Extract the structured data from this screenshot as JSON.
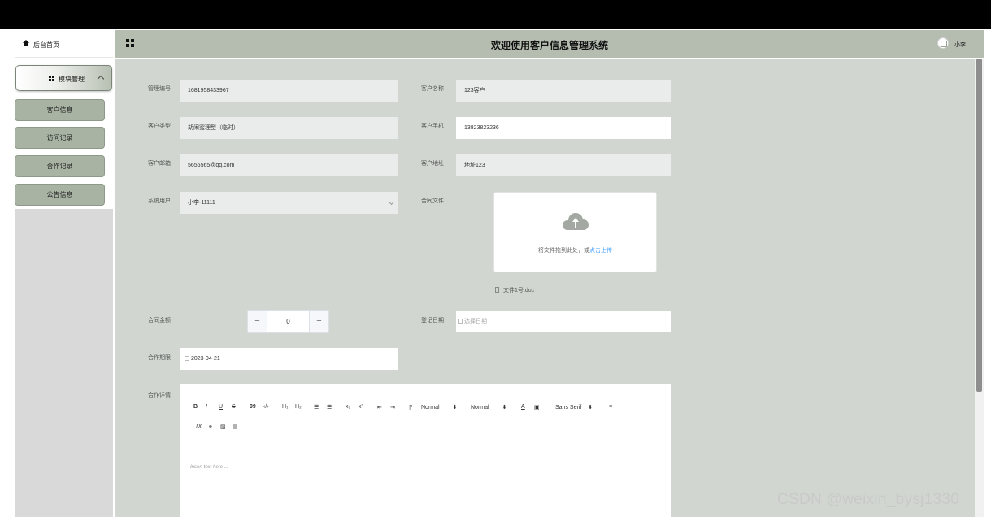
{
  "header": {
    "title": "欢迎使用客户信息管理系统",
    "user_name": "小李"
  },
  "sidebar": {
    "home_label": "后台首页",
    "module_label": "模块管理",
    "items": [
      {
        "label": "客户信息"
      },
      {
        "label": "访问记录"
      },
      {
        "label": "合作记录"
      },
      {
        "label": "公告信息"
      }
    ]
  },
  "form": {
    "manage_no": {
      "label": "管理编号",
      "value": "1681958433967"
    },
    "customer_name": {
      "label": "客户名称",
      "value": "123客户"
    },
    "customer_type": {
      "label": "客户类型",
      "value": "胡闹蜜理型（临时）"
    },
    "customer_phone": {
      "label": "客户手机",
      "value": "13823823236"
    },
    "customer_email": {
      "label": "客户邮箱",
      "value": "5656565@qq.com"
    },
    "customer_address": {
      "label": "客户地址",
      "value": "地址123"
    },
    "system_user": {
      "label": "系统用户",
      "value": "小李-11111"
    },
    "contract_file": {
      "label": "合同文件",
      "upload_text": "将文件拖到此处，或",
      "upload_link": "点击上传",
      "file_name": "文件1号.doc"
    },
    "contract_amount": {
      "label": "合同金额",
      "value": "0",
      "minus": "−",
      "plus": "+"
    },
    "register_date": {
      "label": "登记日期",
      "placeholder": "选择日期"
    },
    "cooperation_period": {
      "label": "合作期限",
      "value": "2023-04-21"
    },
    "cooperation_detail": {
      "label": "合作详情",
      "placeholder": "Insert text here ..."
    }
  },
  "editor_toolbar": {
    "bold": "B",
    "italic": "I",
    "underline": "U",
    "strike": "S",
    "quote": "99",
    "code": "‹/›",
    "h1": "H₁",
    "h2": "H₂",
    "ol": "☰",
    "ul": "☰",
    "sub": "x₂",
    "sup": "x²",
    "outdent": "⇤",
    "indent": "⇥",
    "rtl": "⁋",
    "size_label": "Normal",
    "header_label": "Normal",
    "color": "A",
    "bg": "▣",
    "font_label": "Sans Serif",
    "align": "≡",
    "clean": "Tx",
    "link": "⚭",
    "image": "▨",
    "video": "▤",
    "arrow": "⬍"
  },
  "watermark": "CSDN @weixin_bysj1330",
  "colors": {
    "header_bg": "#b5bdb1",
    "menu_item_bg": "#a8b3a3",
    "main_bg": "#d1d6d0",
    "link": "#409eff"
  }
}
